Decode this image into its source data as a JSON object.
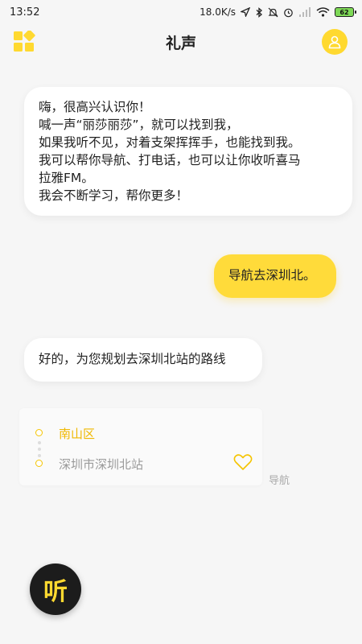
{
  "status": {
    "time": "13:52",
    "net_speed": "18.0K/s",
    "battery": "62"
  },
  "header": {
    "title": "礼声"
  },
  "chat": {
    "bot_greeting": [
      "嗨，很高兴认识你！",
      "喊一声“丽莎丽莎”，就可以找到我，",
      "如果我听不见，对着支架挥挥手，也能找到我。",
      "我可以帮你导航、打电话，也可以让你收听喜马",
      "拉雅FM。",
      "我会不断学习，帮你更多！"
    ],
    "user_message": "导航去深圳北。",
    "bot_reply": "好的，为您规划去深圳北站的路线"
  },
  "route": {
    "origin": "南山区",
    "destination": "深圳市深圳北站",
    "nav_label": "导航"
  },
  "listen_button": {
    "label": "听"
  },
  "colors": {
    "accent": "#ffd930",
    "user_bubble": "#ffdb3a",
    "background": "#f6f6f6",
    "route_origin": "#f0b800",
    "listen_bg": "#1c1c1c"
  },
  "icons": [
    "grid-menu-icon",
    "user-avatar-icon",
    "heart-outline-icon",
    "location-arrow-icon",
    "bluetooth-icon",
    "mute-icon",
    "alarm-icon",
    "signal-icon",
    "wifi-icon",
    "battery-icon"
  ]
}
